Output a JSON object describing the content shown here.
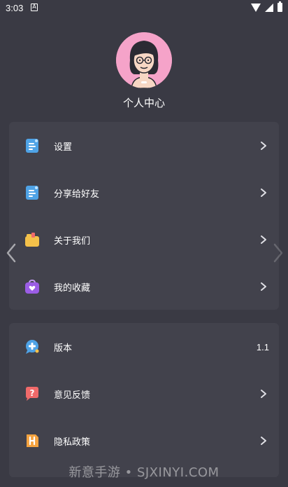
{
  "status_bar": {
    "time": "3:03",
    "notif_glyph": "A"
  },
  "profile": {
    "title": "个人中心",
    "avatar_icon": "woman-avatar-icon"
  },
  "menu_group_1": [
    {
      "label": "设置",
      "icon": "settings-doc-icon"
    },
    {
      "label": "分享给好友",
      "icon": "share-doc-icon"
    },
    {
      "label": "关于我们",
      "icon": "about-folder-icon"
    },
    {
      "label": "我的收藏",
      "icon": "favorite-bag-icon"
    }
  ],
  "menu_group_2": [
    {
      "label": "版本",
      "value": "1.1",
      "icon": "version-chat-icon"
    },
    {
      "label": "意见反馈",
      "icon": "feedback-question-icon"
    },
    {
      "label": "隐私政策",
      "icon": "privacy-h-icon"
    }
  ],
  "watermark": "新意手游 • SJXINYI.COM",
  "colors": {
    "background": "#3a3a44",
    "card": "#42424c",
    "avatar_bg": "#f5a3c9",
    "icon_blue": "#4fa3e6",
    "icon_yellow": "#f4c14a",
    "icon_purple": "#9b5de5",
    "icon_red": "#f06a6a",
    "icon_orange": "#f4a340"
  }
}
